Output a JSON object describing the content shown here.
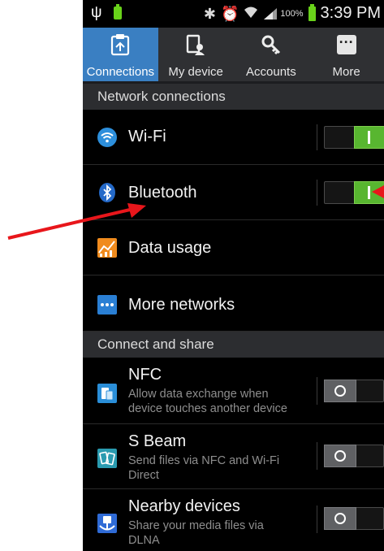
{
  "status_bar": {
    "battery_percent": "100%",
    "time": "3:39 PM"
  },
  "tabs": [
    {
      "label": "Connections",
      "icon": "connections-icon",
      "active": true
    },
    {
      "label": "My device",
      "icon": "my-device-icon",
      "active": false
    },
    {
      "label": "Accounts",
      "icon": "accounts-key-icon",
      "active": false
    },
    {
      "label": "More",
      "icon": "more-dots-icon",
      "active": false
    }
  ],
  "sections": {
    "network": "Network connections",
    "connect_share": "Connect and share"
  },
  "items": {
    "wifi": {
      "label": "Wi-Fi",
      "icon": "wifi-icon",
      "toggle": "on"
    },
    "bluetooth": {
      "label": "Bluetooth",
      "icon": "bluetooth-icon",
      "toggle": "on"
    },
    "data_usage": {
      "label": "Data usage",
      "icon": "data-usage-icon"
    },
    "more_networks": {
      "label": "More networks",
      "icon": "more-networks-icon"
    },
    "nfc": {
      "label": "NFC",
      "subtitle_line1": "Allow data exchange when",
      "subtitle_line2": "device touches another device",
      "icon": "nfc-icon",
      "toggle": "off"
    },
    "sbeam": {
      "label": "S Beam",
      "subtitle_line1": "Send files via NFC and Wi-Fi",
      "subtitle_line2": "Direct",
      "icon": "s-beam-icon",
      "toggle": "off"
    },
    "nearby": {
      "label": "Nearby devices",
      "subtitle_line1": "Share your media files via",
      "subtitle_line2": "DLNA",
      "icon": "nearby-devices-icon",
      "toggle": "off"
    }
  },
  "colors": {
    "active_tab": "#3a7fc2",
    "toggle_on": "#58b630",
    "annotation_arrow": "#e8161b"
  }
}
